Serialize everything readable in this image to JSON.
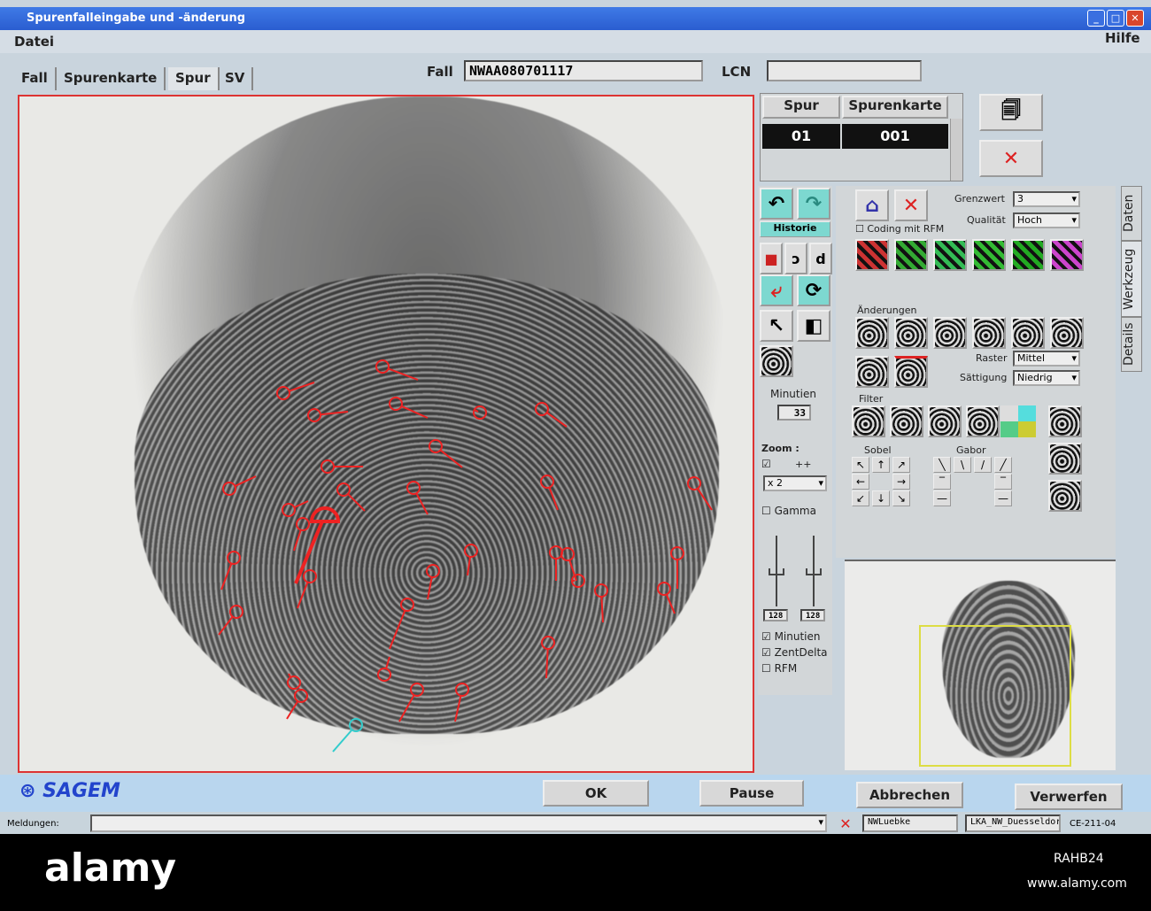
{
  "window": {
    "title": "Spurenfalleingabe und -änderung",
    "min": "_",
    "max": "□",
    "close": "✕"
  },
  "menu": {
    "file": "Datei",
    "help": "Hilfe"
  },
  "tabs": [
    "Fall",
    "Spurenkarte",
    "Spur",
    "SV"
  ],
  "header": {
    "fall_label": "Fall",
    "fall_value": "NWAA080701117",
    "lcn_label": "LCN",
    "lcn_value": ""
  },
  "spur_table": {
    "headers": [
      "Spur",
      "Spurenkarte"
    ],
    "row": [
      "01",
      "001"
    ]
  },
  "tools": {
    "historie": "Historie",
    "grenzwert_label": "Grenzwert",
    "grenzwert_value": "3",
    "qualitaet_label": "Qualität",
    "qualitaet_value": "Hoch",
    "coding_rfm": "Coding mit RFM",
    "aenderungen": "Änderungen",
    "raster_label": "Raster",
    "raster_value": "Mittel",
    "saettigung_label": "Sättigung",
    "saettigung_value": "Niedrig",
    "filter": "Filter",
    "sobel": "Sobel",
    "gabor": "Gabor"
  },
  "left_tools": {
    "minutien_label": "Minutien",
    "minutien_count": "33",
    "zoom_label": "Zoom :",
    "zoom_plus": "++",
    "zoom_value": "x 2",
    "gamma": "Gamma",
    "slider1": "128",
    "slider2": "128",
    "cb_minutien": "Minutien",
    "cb_zentdelta": "ZentDelta",
    "cb_rfm": "RFM"
  },
  "vertical_tabs": [
    "Daten",
    "Werkzeug",
    "Details"
  ],
  "footer": {
    "logo": "SAGEM",
    "ok": "OK",
    "pause": "Pause",
    "abbrechen": "Abbrechen",
    "verwerfen": "Verwerfen"
  },
  "statusbar": {
    "meldungen_label": "Meldungen:",
    "meldungen_value": "",
    "user": "NWLuebke",
    "dept": "LKA_NW_Duesseldorf",
    "station": "CE-211-04"
  },
  "watermark": {
    "logo": "alamy",
    "id": "RAHB24",
    "url": "www.alamy.com"
  }
}
